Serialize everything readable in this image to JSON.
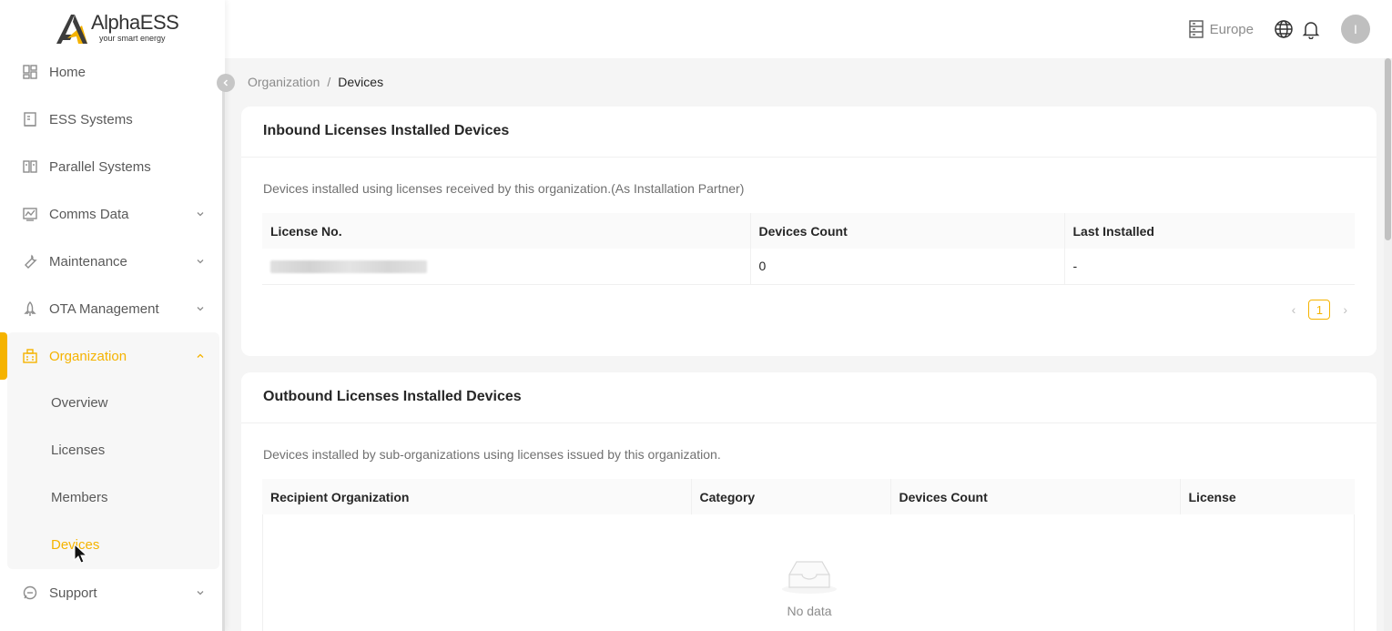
{
  "brand": {
    "name": "AlphaESS",
    "tagline": "your smart energy",
    "accent": "#f5b300"
  },
  "sidebar": {
    "items": [
      {
        "label": "Home",
        "icon": "home-grid-icon"
      },
      {
        "label": "ESS Systems",
        "icon": "building-icon"
      },
      {
        "label": "Parallel Systems",
        "icon": "parallel-icon"
      },
      {
        "label": "Comms Data",
        "icon": "chart-icon",
        "expandable": true
      },
      {
        "label": "Maintenance",
        "icon": "wrench-icon",
        "expandable": true
      },
      {
        "label": "OTA Management",
        "icon": "rocket-icon",
        "expandable": true
      },
      {
        "label": "Organization",
        "icon": "org-icon",
        "expandable": true,
        "active": true
      },
      {
        "label": "Support",
        "icon": "headset-icon",
        "expandable": true
      }
    ],
    "org_sub": [
      "Overview",
      "Licenses",
      "Members",
      "Devices"
    ],
    "active_sub": "Devices"
  },
  "header": {
    "region": "Europe",
    "avatar_initial": "I"
  },
  "breadcrumb": {
    "parent": "Organization",
    "separator": "/",
    "current": "Devices"
  },
  "inbound": {
    "title": "Inbound Licenses Installed Devices",
    "description": "Devices installed using licenses received by this organization.(As Installation Partner)",
    "columns": [
      "License No.",
      "Devices Count",
      "Last Installed"
    ],
    "rows": [
      {
        "license": "",
        "count": "0",
        "last": "-"
      }
    ],
    "page": "1"
  },
  "outbound": {
    "title": "Outbound Licenses Installed Devices",
    "description": "Devices installed by sub-organizations using licenses issued by this organization.",
    "columns": [
      "Recipient Organization",
      "Category",
      "Devices Count",
      "License"
    ],
    "empty_text": "No data"
  }
}
